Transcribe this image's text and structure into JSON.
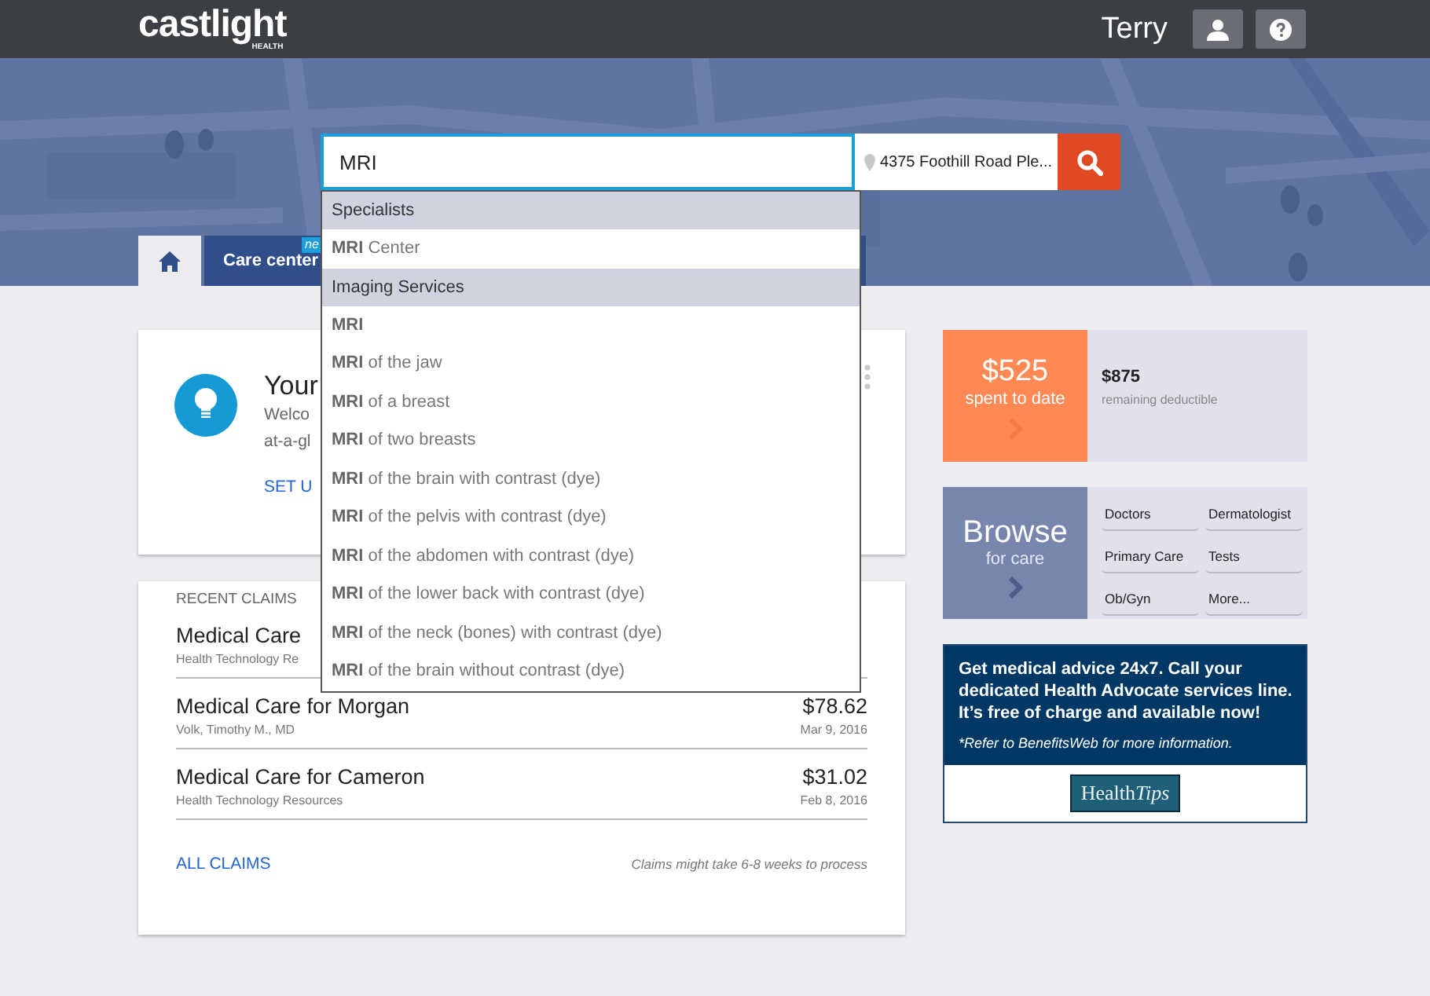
{
  "header": {
    "logo": "castlight",
    "logo_sub": "HEALTH",
    "user_name": "Terry"
  },
  "search": {
    "value": "MRI",
    "location": "4375 Foothill Road Ple...",
    "suggestions": [
      {
        "kind": "header",
        "text": "Specialists"
      },
      {
        "kind": "option",
        "text": "**MRI** Center"
      },
      {
        "kind": "header",
        "text": "Imaging Services"
      },
      {
        "kind": "option",
        "text": "**MRI**"
      },
      {
        "kind": "option",
        "text": "**MRI** of the jaw"
      },
      {
        "kind": "option",
        "text": "**MRI** of a breast"
      },
      {
        "kind": "option",
        "text": "**MRI** of two breasts"
      },
      {
        "kind": "option",
        "text": "**MRI** of the brain with contrast (dye)"
      },
      {
        "kind": "option",
        "text": "**MRI** of the pelvis with contrast (dye)"
      },
      {
        "kind": "option",
        "text": "**MRI** of the abdomen with contrast (dye)"
      },
      {
        "kind": "option",
        "text": "**MRI** of the lower back with contrast (dye)"
      },
      {
        "kind": "option",
        "text": "**MRI** of the neck (bones) with contrast (dye)"
      },
      {
        "kind": "option",
        "text": "**MRI** of the brain without contrast (dye)"
      }
    ]
  },
  "tabs": [
    {
      "kind": "home",
      "selected": true
    },
    {
      "kind": "label",
      "label": "Care center",
      "badge": "ne",
      "selected": false
    }
  ],
  "welcome_card": {
    "title": "Your",
    "text_lines": [
      "Welco",
      "at-a-gl"
    ],
    "link": "SET U"
  },
  "claims": {
    "title": "RECENT CLAIMS",
    "rows": [
      {
        "title": "Medical Care",
        "provider": "Health Technology Re"
      },
      {
        "title": "Medical Care for Morgan",
        "amount": "$78.62",
        "provider": "Volk, Timothy M., MD",
        "date": "Mar 9, 2016"
      },
      {
        "title": "Medical Care for Cameron",
        "amount": "$31.02",
        "provider": "Health Technology Resources",
        "date": "Feb 8, 2016"
      }
    ],
    "link": "ALL CLAIMS",
    "note": "Claims might take 6-8 weeks to process"
  },
  "deductible": {
    "spent": "$525",
    "spent_label": "spent to date",
    "remaining": "$875",
    "remaining_label": "remaining deductible"
  },
  "browse": {
    "title": "Browse",
    "subtitle": "for care",
    "links": [
      "Doctors",
      "Dermatologist",
      "Primary Care",
      "Tests",
      "Ob/Gyn",
      "More..."
    ]
  },
  "ad": {
    "text": "Get medical advice 24x7. Call your dedicated Health Advocate services line. It’s free of charge and available now!",
    "note": "*Refer to BenefitsWeb for more information.",
    "logo_left": "Health",
    "logo_right": "Tips"
  }
}
